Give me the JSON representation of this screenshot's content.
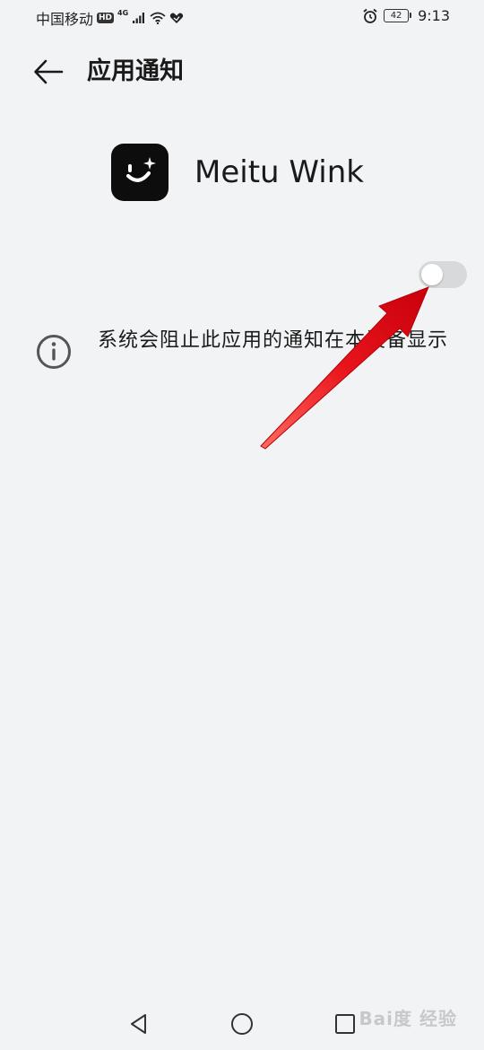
{
  "status_bar": {
    "carrier": "中国移动",
    "hd_badge": "HD",
    "network_type": "4G",
    "battery_level": "42",
    "time": "9:13"
  },
  "header": {
    "title": "应用通知"
  },
  "app": {
    "name": "Meitu Wink"
  },
  "notification_toggle": {
    "state": "off"
  },
  "info": {
    "message": "系统会阻止此应用的通知在本设备显示"
  },
  "watermark": "Bai度 经验",
  "colors": {
    "background": "#f1f3f5",
    "toggle_off": "#d8d9db",
    "annotation_arrow": "#e8141c"
  },
  "icons": {
    "back": "arrow-left-icon",
    "info": "info-circle-icon",
    "nav_back": "triangle-back-icon",
    "nav_home": "circle-home-icon",
    "nav_recent": "square-recent-icon"
  }
}
